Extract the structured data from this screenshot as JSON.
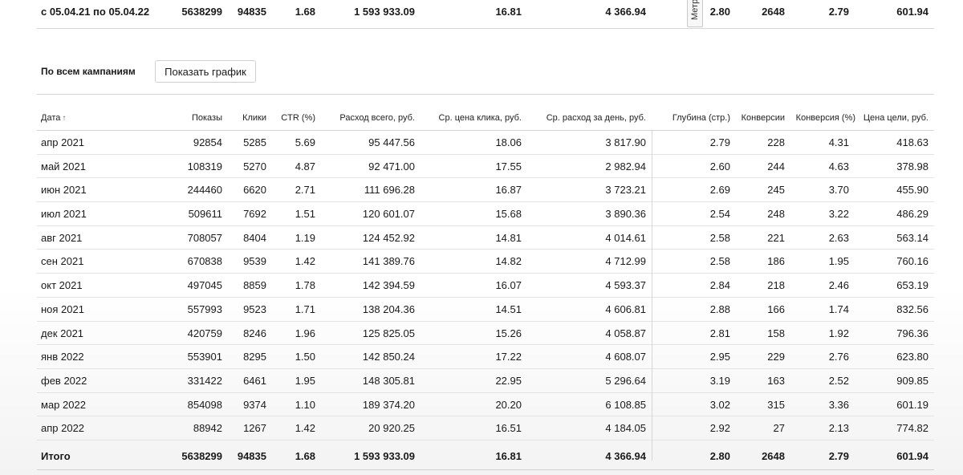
{
  "summary_row": {
    "period": "с 05.04.21 по 05.04.22",
    "impressions": "5638299",
    "clicks": "94835",
    "ctr": "1.68",
    "spend": "1 593 933.09",
    "avg_cpc": "16.81",
    "avg_daily_spend": "4 366.94",
    "depth": "2.80",
    "conversions": "2648",
    "conversion_rate": "2.79",
    "goal_cost": "601.94"
  },
  "metrika_tab_label": "Метр",
  "section": {
    "title": "По всем кампаниям",
    "show_chart_label": "Показать график"
  },
  "table": {
    "headers": {
      "date": "Дата",
      "sort_arrow": "↑",
      "impressions": "Показы",
      "clicks": "Клики",
      "ctr": "CTR (%)",
      "spend": "Расход всего, руб.",
      "avg_cpc": "Ср. цена клика, руб.",
      "avg_daily_spend": "Ср. расход за день, руб.",
      "depth": "Глубина (стр.)",
      "conversions": "Конверсии",
      "conversion_rate": "Конверсия (%)",
      "goal_cost": "Цена цели, руб."
    },
    "rows": [
      {
        "date": "апр 2021",
        "impressions": "92854",
        "clicks": "5285",
        "ctr": "5.69",
        "spend": "95 447.56",
        "avg_cpc": "18.06",
        "avg_daily_spend": "3 817.90",
        "depth": "2.79",
        "conversions": "228",
        "conversion_rate": "4.31",
        "goal_cost": "418.63"
      },
      {
        "date": "май 2021",
        "impressions": "108319",
        "clicks": "5270",
        "ctr": "4.87",
        "spend": "92 471.00",
        "avg_cpc": "17.55",
        "avg_daily_spend": "2 982.94",
        "depth": "2.60",
        "conversions": "244",
        "conversion_rate": "4.63",
        "goal_cost": "378.98"
      },
      {
        "date": "июн 2021",
        "impressions": "244460",
        "clicks": "6620",
        "ctr": "2.71",
        "spend": "111 696.28",
        "avg_cpc": "16.87",
        "avg_daily_spend": "3 723.21",
        "depth": "2.69",
        "conversions": "245",
        "conversion_rate": "3.70",
        "goal_cost": "455.90"
      },
      {
        "date": "июл 2021",
        "impressions": "509611",
        "clicks": "7692",
        "ctr": "1.51",
        "spend": "120 601.07",
        "avg_cpc": "15.68",
        "avg_daily_spend": "3 890.36",
        "depth": "2.54",
        "conversions": "248",
        "conversion_rate": "3.22",
        "goal_cost": "486.29"
      },
      {
        "date": "авг 2021",
        "impressions": "708057",
        "clicks": "8404",
        "ctr": "1.19",
        "spend": "124 452.92",
        "avg_cpc": "14.81",
        "avg_daily_spend": "4 014.61",
        "depth": "2.58",
        "conversions": "221",
        "conversion_rate": "2.63",
        "goal_cost": "563.14"
      },
      {
        "date": "сен 2021",
        "impressions": "670838",
        "clicks": "9539",
        "ctr": "1.42",
        "spend": "141 389.76",
        "avg_cpc": "14.82",
        "avg_daily_spend": "4 712.99",
        "depth": "2.58",
        "conversions": "186",
        "conversion_rate": "1.95",
        "goal_cost": "760.16"
      },
      {
        "date": "окт 2021",
        "impressions": "497045",
        "clicks": "8859",
        "ctr": "1.78",
        "spend": "142 394.59",
        "avg_cpc": "16.07",
        "avg_daily_spend": "4 593.37",
        "depth": "2.84",
        "conversions": "218",
        "conversion_rate": "2.46",
        "goal_cost": "653.19"
      },
      {
        "date": "ноя 2021",
        "impressions": "557993",
        "clicks": "9523",
        "ctr": "1.71",
        "spend": "138 204.36",
        "avg_cpc": "14.51",
        "avg_daily_spend": "4 606.81",
        "depth": "2.88",
        "conversions": "166",
        "conversion_rate": "1.74",
        "goal_cost": "832.56"
      },
      {
        "date": "дек 2021",
        "impressions": "420759",
        "clicks": "8246",
        "ctr": "1.96",
        "spend": "125 825.05",
        "avg_cpc": "15.26",
        "avg_daily_spend": "4 058.87",
        "depth": "2.81",
        "conversions": "158",
        "conversion_rate": "1.92",
        "goal_cost": "796.36"
      },
      {
        "date": "янв 2022",
        "impressions": "553901",
        "clicks": "8295",
        "ctr": "1.50",
        "spend": "142 850.24",
        "avg_cpc": "17.22",
        "avg_daily_spend": "4 608.07",
        "depth": "2.95",
        "conversions": "229",
        "conversion_rate": "2.76",
        "goal_cost": "623.80"
      },
      {
        "date": "фев 2022",
        "impressions": "331422",
        "clicks": "6461",
        "ctr": "1.95",
        "spend": "148 305.81",
        "avg_cpc": "22.95",
        "avg_daily_spend": "5 296.64",
        "depth": "3.19",
        "conversions": "163",
        "conversion_rate": "2.52",
        "goal_cost": "909.85"
      },
      {
        "date": "мар 2022",
        "impressions": "854098",
        "clicks": "9374",
        "ctr": "1.10",
        "spend": "189 374.20",
        "avg_cpc": "20.20",
        "avg_daily_spend": "6 108.85",
        "depth": "3.02",
        "conversions": "315",
        "conversion_rate": "3.36",
        "goal_cost": "601.19"
      },
      {
        "date": "апр 2022",
        "impressions": "88942",
        "clicks": "1267",
        "ctr": "1.42",
        "spend": "20 920.25",
        "avg_cpc": "16.51",
        "avg_daily_spend": "4 184.05",
        "depth": "2.92",
        "conversions": "27",
        "conversion_rate": "2.13",
        "goal_cost": "774.82"
      }
    ],
    "total": {
      "label": "Итого",
      "impressions": "5638299",
      "clicks": "94835",
      "ctr": "1.68",
      "spend": "1 593 933.09",
      "avg_cpc": "16.81",
      "avg_daily_spend": "4 366.94",
      "depth": "2.80",
      "conversions": "2648",
      "conversion_rate": "2.79",
      "goal_cost": "601.94"
    }
  }
}
